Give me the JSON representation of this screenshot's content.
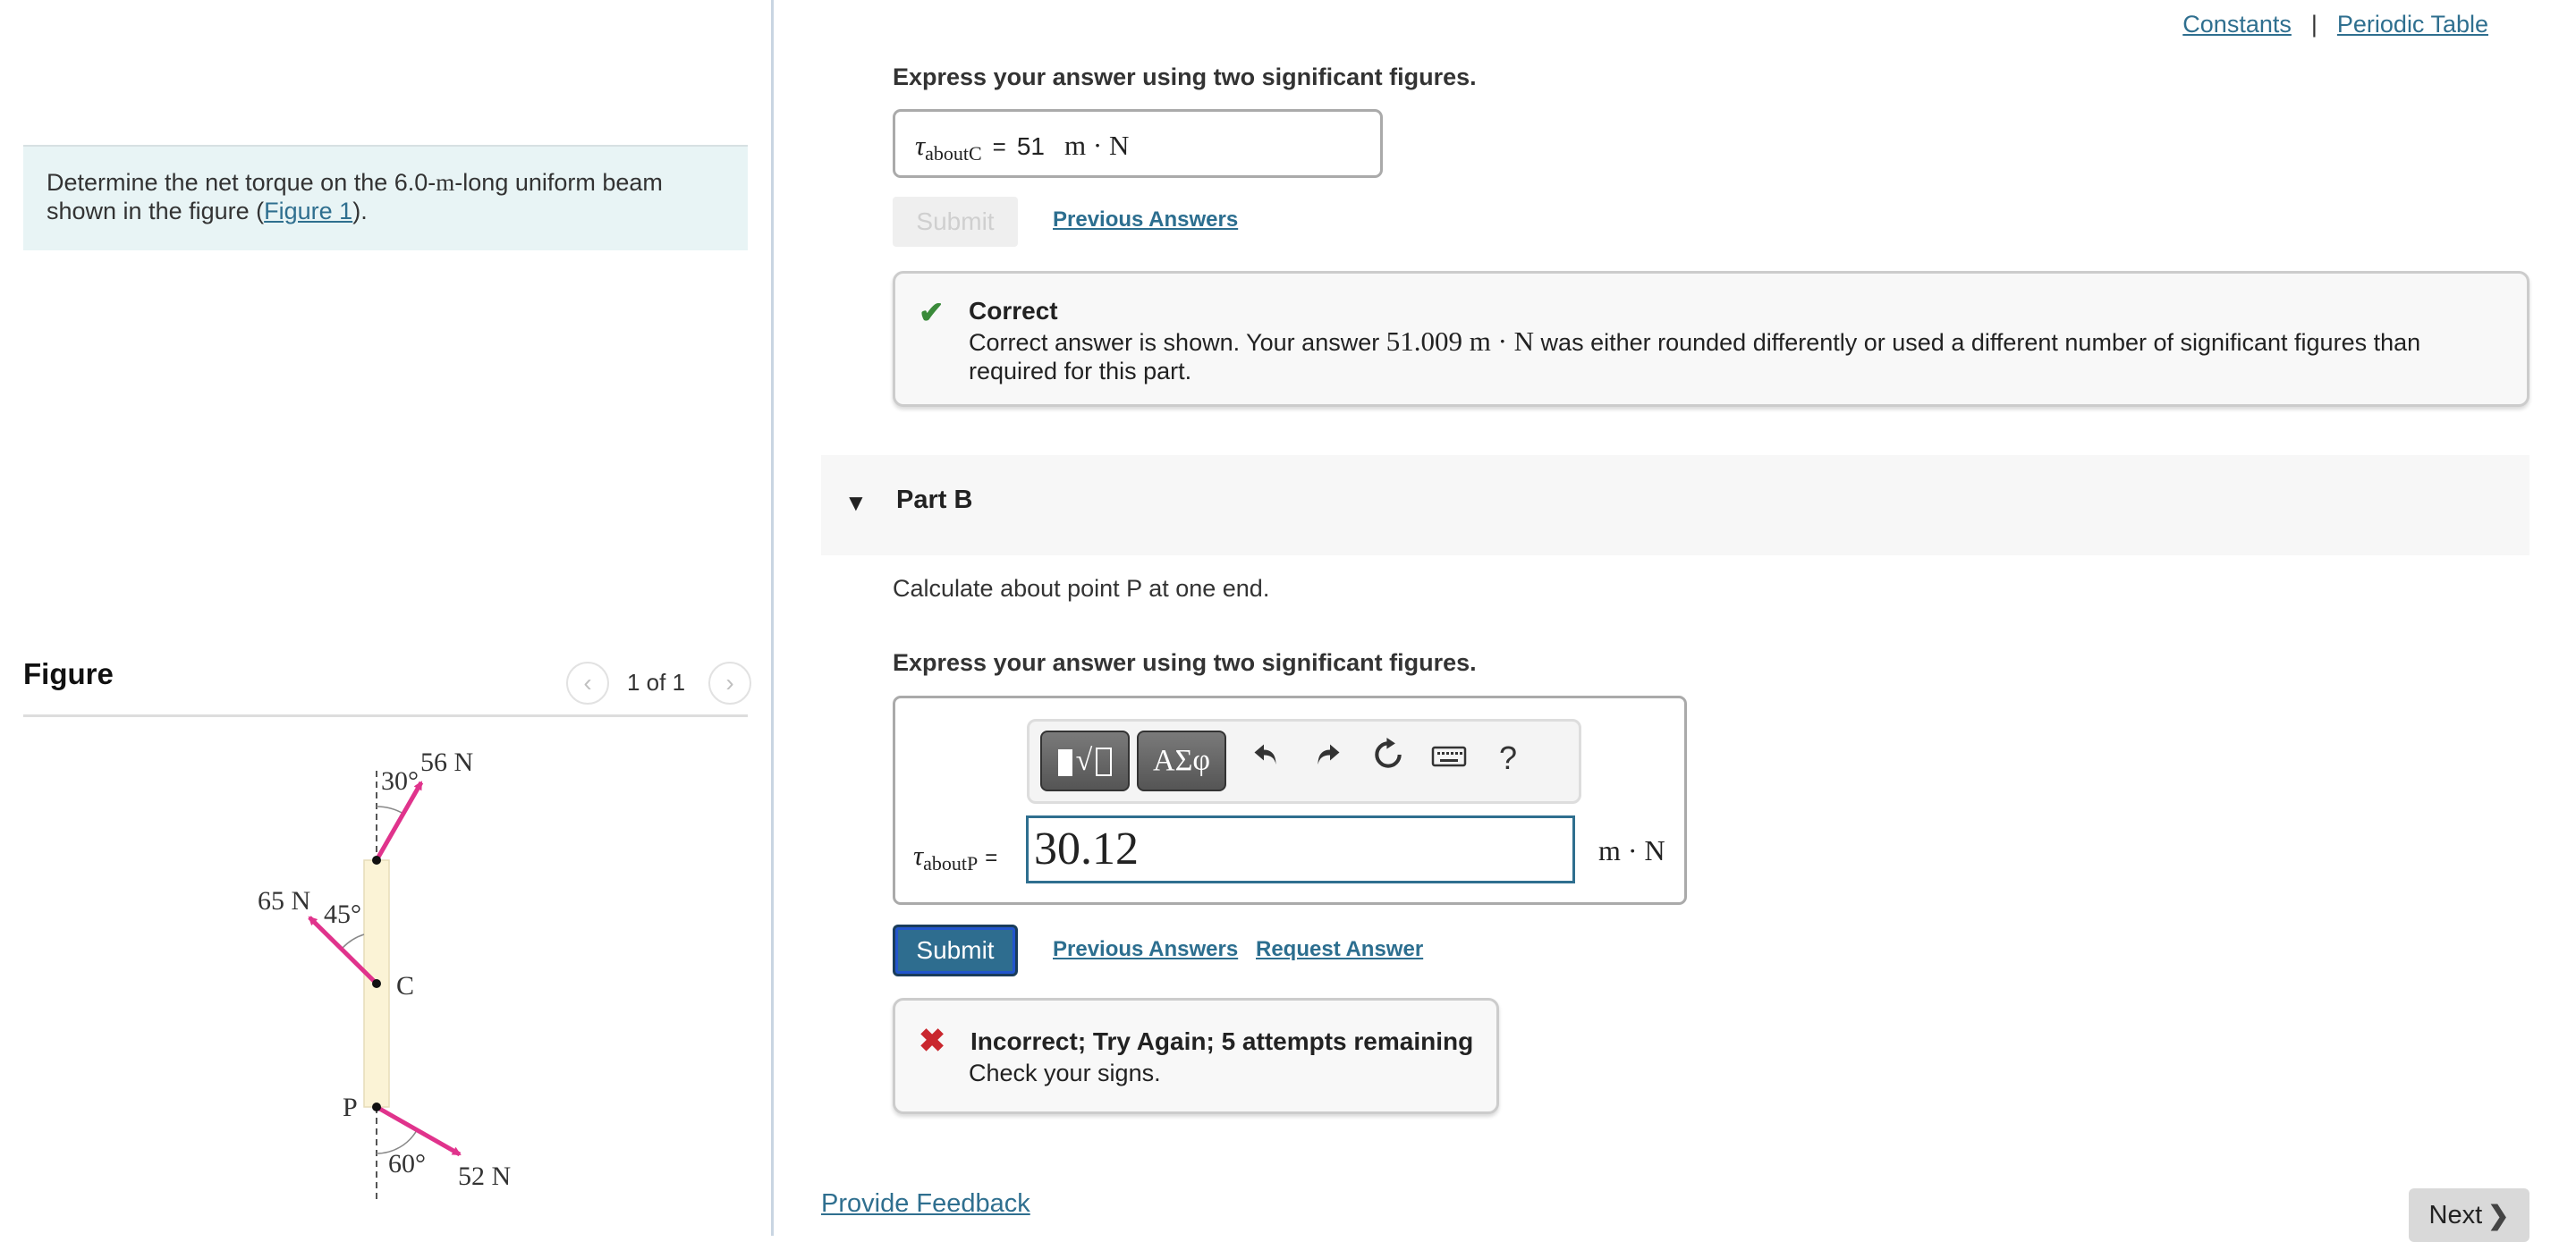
{
  "header": {
    "links": [
      "Constants",
      "Periodic Table"
    ],
    "separator": "|"
  },
  "problem": {
    "text_before": "Determine the net torque on the 6.0-",
    "unit_m": "m",
    "text_after": "-long uniform beam shown in the figure (",
    "figure_link": "Figure 1",
    "text_end": ")."
  },
  "figure": {
    "title": "Figure",
    "pager": "1 of 1",
    "diagram": {
      "forces": [
        {
          "label": "56 N",
          "angle_label": "30°",
          "point": "top"
        },
        {
          "label": "65 N",
          "angle_label": "45°",
          "point": "C"
        },
        {
          "label": "52 N",
          "angle_label": "60°",
          "point": "P"
        }
      ],
      "points": [
        "C",
        "P"
      ],
      "colors": {
        "beam": "#fbf3d6",
        "arrow": "#e0338c"
      }
    }
  },
  "part_a": {
    "instruction": "Express your answer using two significant figures.",
    "symbol": "τ",
    "subscript": "aboutC",
    "equals": "=",
    "value": "51",
    "unit": "m · N",
    "submit_label": "Submit",
    "previous_answers": "Previous Answers",
    "feedback": {
      "title": "Correct",
      "body_before": "Correct answer is shown. Your answer ",
      "answer_value": "51.009 m · N",
      "body_after": " was either rounded differently or used a different number of significant figures than required for this part."
    }
  },
  "part_b": {
    "header": "Part B",
    "prompt": "Calculate about point P at one end.",
    "instruction": "Express your answer using two significant figures.",
    "toolbar": {
      "templates": "▮√▯",
      "greek": "ΑΣφ",
      "undo": "↶",
      "redo": "↷",
      "reset": "↻",
      "keyboard": "⌨",
      "help": "?"
    },
    "symbol": "τ",
    "subscript": "aboutP",
    "equals": "=",
    "input_value": "30.12",
    "unit": "m · N",
    "submit_label": "Submit",
    "previous_answers": "Previous Answers",
    "request_answer": "Request Answer",
    "feedback": {
      "title": "Incorrect; Try Again; 5 attempts remaining",
      "body": "Check your signs."
    }
  },
  "footer": {
    "feedback_link": "Provide Feedback",
    "next_label": "Next"
  },
  "colors": {
    "link": "#2f6f8f",
    "correct": "#3a8a3a",
    "incorrect": "#c9272e",
    "submit": "#2e6d8f"
  }
}
